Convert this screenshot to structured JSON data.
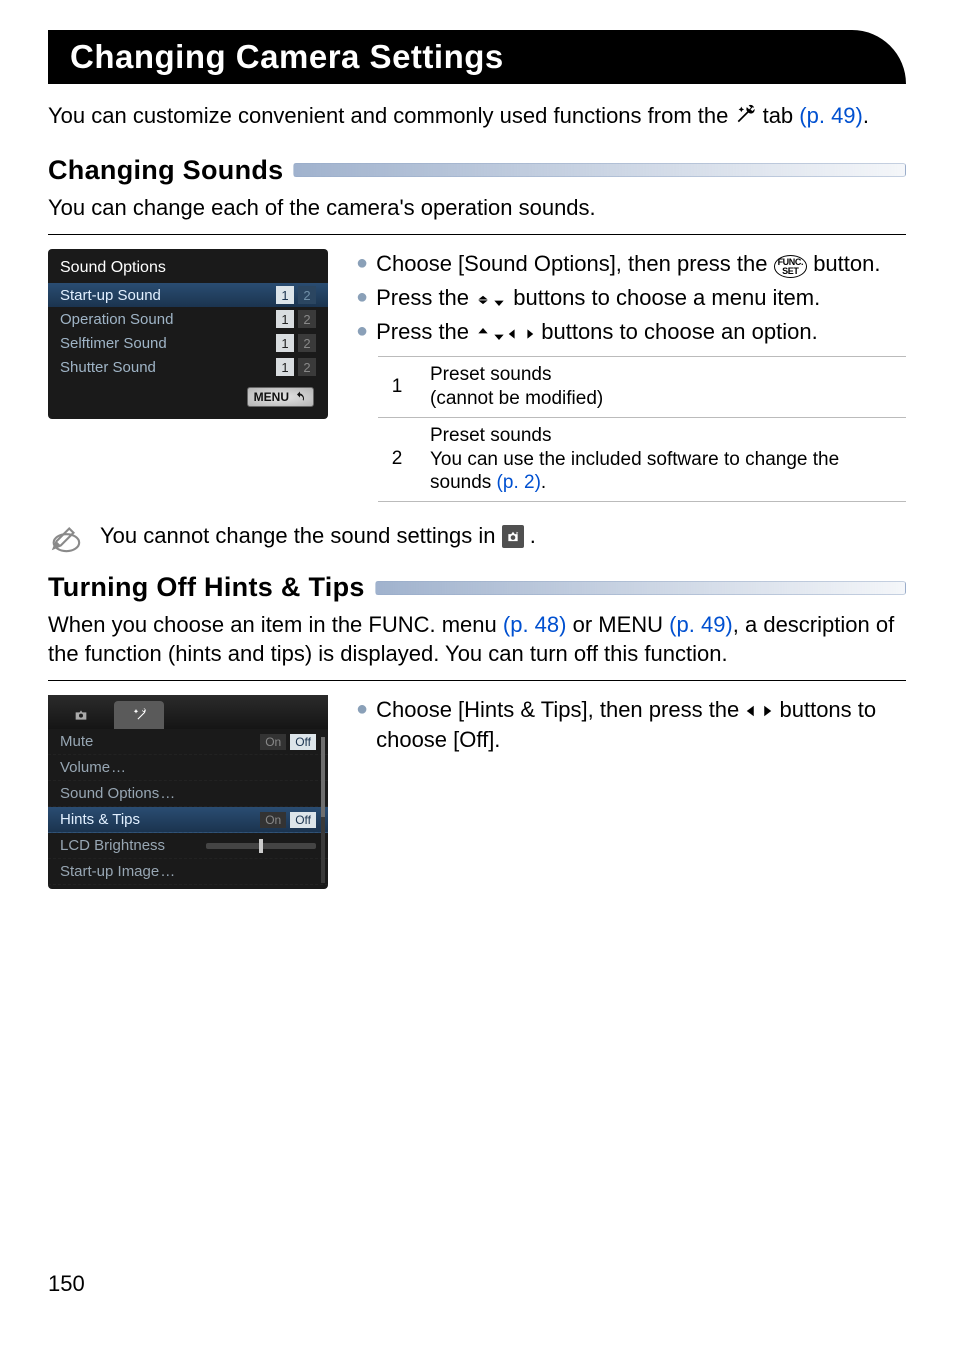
{
  "page_number": "150",
  "title": "Changing Camera Settings",
  "intro": {
    "text_before_icon": "You can customize convenient and commonly used functions from the ",
    "text_after_icon": " tab ",
    "link": "(p. 49)",
    "trailing": "."
  },
  "section1": {
    "heading": "Changing Sounds",
    "desc": "You can change each of the camera's operation sounds.",
    "lcd": {
      "title": "Sound Options",
      "rows": [
        {
          "label": "Start-up Sound",
          "active": "1",
          "inactive": "2",
          "selected": true
        },
        {
          "label": "Operation Sound",
          "active": "1",
          "inactive": "2",
          "selected": false
        },
        {
          "label": "Selftimer Sound",
          "active": "1",
          "inactive": "2",
          "selected": false
        },
        {
          "label": "Shutter Sound",
          "active": "1",
          "inactive": "2",
          "selected": false
        }
      ],
      "menu_label": "MENU"
    },
    "bullets": [
      {
        "pre": "Choose [Sound Options], then press the ",
        "mid_button": "FUNC SET",
        "post": " button."
      },
      {
        "pre": "Press the ",
        "nav": "updown",
        "post": " buttons to choose a menu item."
      },
      {
        "pre": "Press the ",
        "nav": "all",
        "post": " buttons to choose an option."
      }
    ],
    "options": [
      {
        "key": "1",
        "text": "Preset sounds\n(cannot be modified)"
      },
      {
        "key": "2",
        "text_pre": "Preset sounds\nYou can use the included software to change the sounds ",
        "link": "(p. 2)",
        "trailing": "."
      }
    ],
    "note": "You cannot change the sound settings in "
  },
  "section2": {
    "heading": "Turning Off Hints & Tips",
    "desc_pre": "When you choose an item in the FUNC. menu ",
    "desc_link1": "(p. 48)",
    "desc_mid": " or MENU ",
    "desc_link2": "(p. 49)",
    "desc_post": ", a description of the function (hints and tips) is displayed. You can turn off this function.",
    "lcd": {
      "rows": [
        {
          "label": "Mute",
          "right_type": "onoff",
          "active": "Off",
          "options": [
            "On",
            "Off"
          ]
        },
        {
          "label": "Volume",
          "right_type": "more"
        },
        {
          "label": "Sound Options",
          "right_type": "more"
        },
        {
          "label": "Hints & Tips",
          "right_type": "onoff",
          "active": "Off",
          "options": [
            "On",
            "Off"
          ],
          "selected": true
        },
        {
          "label": "LCD Brightness",
          "right_type": "slider"
        },
        {
          "label": "Start-up Image",
          "right_type": "more"
        }
      ]
    },
    "bullet": {
      "pre": "Choose [Hints & Tips], then press the ",
      "nav": "leftright",
      "post": " buttons to choose [Off]."
    }
  }
}
